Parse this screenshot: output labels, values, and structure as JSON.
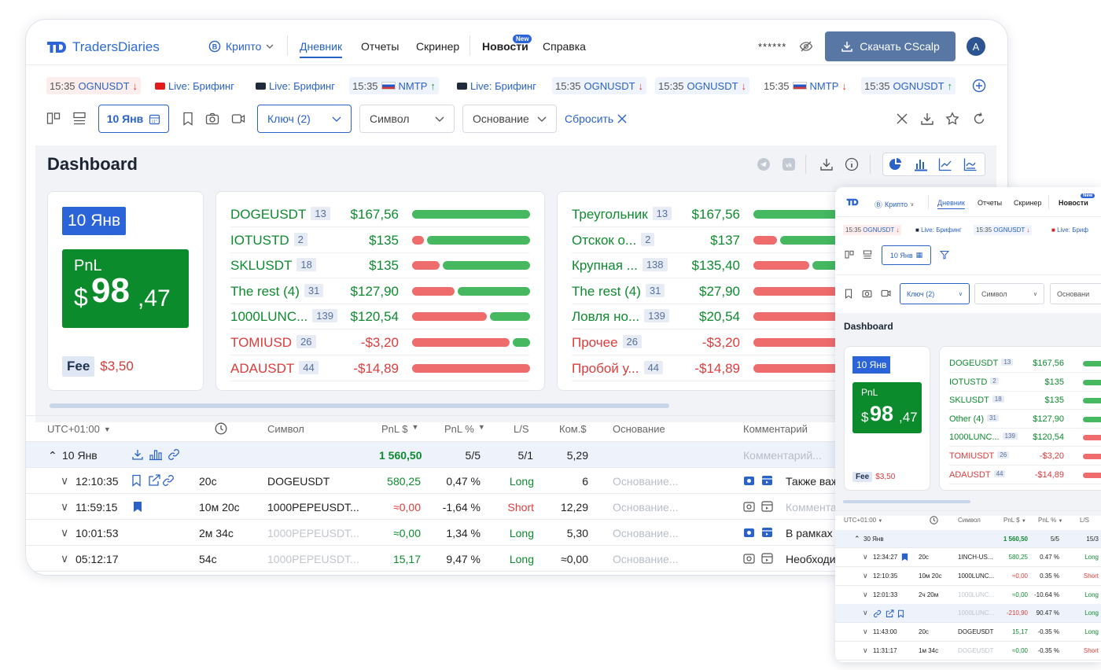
{
  "app": {
    "name": "TradersDiaries",
    "mode": "Крипто",
    "avatar": "A",
    "masked": "******",
    "download": "Скачать CScalp"
  },
  "nav": [
    {
      "label": "Дневник",
      "active": true
    },
    {
      "label": "Отчеты"
    },
    {
      "label": "Скринер"
    },
    {
      "label": "Новости",
      "badge": "New"
    },
    {
      "label": "Справка"
    }
  ],
  "tickers": [
    {
      "time": "15:35",
      "sym": "OGNUSDT",
      "dir": "down",
      "style": "red"
    },
    {
      "live": "Live: Брифинг",
      "style": "none",
      "icon": "youtube-red"
    },
    {
      "live": "Live: Брифинг",
      "style": "none",
      "icon": "youtube-dark"
    },
    {
      "time": "15:35",
      "sym": "NMTP",
      "dir": "up",
      "style": "blue",
      "flag": true
    },
    {
      "live": "Live: Брифинг",
      "style": "none",
      "icon": "youtube-dark"
    },
    {
      "time": "15:35",
      "sym": "OGNUSDT",
      "dir": "down",
      "style": "blue"
    },
    {
      "time": "15:35",
      "sym": "OGNUSDT",
      "dir": "down",
      "style": "blue"
    },
    {
      "time": "15:35",
      "sym": "NMTP",
      "dir": "down",
      "style": "none",
      "flag": true
    },
    {
      "time": "15:35",
      "sym": "OGNUSDT",
      "dir": "up",
      "style": "blue"
    }
  ],
  "filters": {
    "date": "10 Янв",
    "key": "Ключ (2)",
    "symbol": "Символ",
    "reason": "Основание",
    "reset": "Сбросить"
  },
  "dashboard": {
    "title": "Dashboard",
    "date": "10 Янв",
    "pnl_label": "PnL",
    "pnl_currency": "$",
    "pnl_int": "98",
    "pnl_dec": ",47",
    "fee_label": "Fee",
    "fee_value": "$3,50",
    "symbols": [
      {
        "name": "DOGEUSDT",
        "count": "13",
        "value": "$167,56",
        "sign": "pos",
        "red": 0.0,
        "green": 1.0
      },
      {
        "name": "IOTUSTD",
        "count": "2",
        "value": "$135",
        "sign": "pos",
        "red": 0.1,
        "green": 0.9
      },
      {
        "name": "SKLUSDT",
        "count": "18",
        "value": "$135",
        "sign": "pos",
        "red": 0.24,
        "green": 0.76
      },
      {
        "name": "The rest (4)",
        "count": "31",
        "value": "$127,90",
        "sign": "pos",
        "red": 0.37,
        "green": 0.63
      },
      {
        "name": "1000LUNC...",
        "count": "139",
        "value": "$120,54",
        "sign": "pos",
        "red": 0.65,
        "green": 0.35
      },
      {
        "name": "TOMIUSD",
        "count": "26",
        "value": "-$3,20",
        "sign": "neg",
        "red": 0.85,
        "green": 0.15
      },
      {
        "name": "ADAUSDT",
        "count": "44",
        "value": "-$14,89",
        "sign": "neg",
        "red": 1.0,
        "green": 0.0
      }
    ],
    "reasons": [
      {
        "name": "Треугольник",
        "count": "13",
        "value": "$167,56",
        "sign": "pos"
      },
      {
        "name": "Отскок о...",
        "count": "2",
        "value": "$137",
        "sign": "pos"
      },
      {
        "name": "Крупная ...",
        "count": "138",
        "value": "$135,40",
        "sign": "pos"
      },
      {
        "name": "The rest (4)",
        "count": "31",
        "value": "$27,90",
        "sign": "pos"
      },
      {
        "name": "Ловля но...",
        "count": "139",
        "value": "$20,54",
        "sign": "pos"
      },
      {
        "name": "Прочее",
        "count": "26",
        "value": "-$3,20",
        "sign": "neg"
      },
      {
        "name": "Пробой у...",
        "count": "44",
        "value": "-$14,89",
        "sign": "neg"
      }
    ]
  },
  "table": {
    "headers": {
      "tz": "UTC+01:00",
      "symbol": "Символ",
      "pnl": "PnL $",
      "pnlp": "PnL %",
      "ls": "L/S",
      "fee": "Ком.$",
      "reason": "Основание",
      "comment": "Комментарий"
    },
    "group": {
      "label": "10 Янв",
      "pnl": "1 560,50",
      "pnlp": "5/5",
      "ls": "5/1",
      "fee": "5,29",
      "comment": "Комментарий..."
    },
    "rows": [
      {
        "time": "12:10:35",
        "dur": "20с",
        "sym": "DOGEUSDT",
        "symGrey": false,
        "pnl": "580,25",
        "pnlSign": "pos",
        "pnlp": "0,47 %",
        "ls": "Long",
        "fee": "6",
        "reason": "Основание...",
        "comment": "Также важ",
        "commentPh": false,
        "icons": true,
        "bookmark": false
      },
      {
        "time": "11:59:15",
        "dur": "10м 20с",
        "sym": "1000PEPEUSDT...",
        "symGrey": false,
        "pnl": "≈0,00",
        "pnlSign": "neg",
        "pnlp": "-1,64 %",
        "ls": "Short",
        "fee": "12,29",
        "reason": "Основание...",
        "comment": "Коммента",
        "commentPh": true,
        "icons": false,
        "bookmark": true
      },
      {
        "time": "10:01:53",
        "dur": "2м 34с",
        "sym": "1000PEPEUSDT...",
        "symGrey": true,
        "pnl": "≈0,00",
        "pnlSign": "pos",
        "pnlp": "1,34 %",
        "ls": "Long",
        "fee": "5,30",
        "reason": "Основание...",
        "comment": "В рамках",
        "commentPh": false,
        "icons": false,
        "bookmark": false
      },
      {
        "time": "05:12:17",
        "dur": "54с",
        "sym": "1000PEPEUSDT...",
        "symGrey": true,
        "pnl": "15,17",
        "pnlSign": "pos",
        "pnlp": "9,47 %",
        "ls": "Long",
        "fee": "≈0,00",
        "reason": "Основание...",
        "comment": "Необходи",
        "commentPh": false,
        "icons": false,
        "bookmark": false
      }
    ]
  },
  "mobile": {
    "nav": [
      "Дневник",
      "Отчеты",
      "Скринер",
      "Новости"
    ],
    "badge": "New",
    "mode": "Крипто",
    "tickers": [
      {
        "time": "15:35",
        "sym": "OGNUSDT"
      },
      {
        "live": "Live: Брифинг"
      },
      {
        "time": "15:35",
        "sym": "OGNUSDT"
      },
      {
        "live": "Live: Бриф"
      }
    ],
    "date": "10 Янв",
    "key": "Ключ (2)",
    "symbol": "Символ",
    "reason": "Основани",
    "title": "Dashboard",
    "pnl_label": "PnL",
    "pnl_currency": "$",
    "pnl_int": "98",
    "pnl_dec": ",47",
    "fee_label": "Fee",
    "fee_value": "$3,50",
    "symbols": [
      {
        "name": "DOGEUSDT",
        "count": "13",
        "value": "$167,56",
        "sign": "pos"
      },
      {
        "name": "IOTUSTD",
        "count": "2",
        "value": "$135",
        "sign": "pos"
      },
      {
        "name": "SKLUSDT",
        "count": "18",
        "value": "$135",
        "sign": "pos"
      },
      {
        "name": "Other (4)",
        "count": "31",
        "value": "$127,90",
        "sign": "pos"
      },
      {
        "name": "1000LUNC...",
        "count": "139",
        "value": "$120,54",
        "sign": "pos"
      },
      {
        "name": "TOMIUSDT",
        "count": "26",
        "value": "-$3,20",
        "sign": "neg"
      },
      {
        "name": "ADAUSDT",
        "count": "44",
        "value": "-$14,89",
        "sign": "neg"
      }
    ],
    "headers": {
      "tz": "UTC+01:00",
      "symbol": "Символ",
      "pnl": "PnL $",
      "pnlp": "PnL %",
      "ls": "L/S"
    },
    "group": {
      "label": "30 Янв",
      "pnl": "1 560,50",
      "pnlp": "5/5",
      "ls": "15/3"
    },
    "rows": [
      {
        "time": "12:34:27",
        "dur": "20с",
        "sym": "1INCH-US...",
        "grey": false,
        "pnl": "580,25",
        "pnlSign": "pos",
        "pnlp": "0.47 %",
        "ls": "Long"
      },
      {
        "time": "12:10:35",
        "dur": "10м 20с",
        "sym": "1000LUNC...",
        "grey": false,
        "pnl": "≈0,00",
        "pnlSign": "neg",
        "pnlp": "0.35 %",
        "ls": "Short"
      },
      {
        "time": "12:01:33",
        "dur": "2ч 20м",
        "sym": "1000LUNC...",
        "grey": true,
        "pnl": "≈0,00",
        "pnlSign": "pos",
        "pnlp": "-10.64 %",
        "ls": "Long"
      },
      {
        "time": "",
        "dur": "",
        "sym": "1000LUNC...",
        "grey": true,
        "pnl": "-210,90",
        "pnlSign": "neg",
        "pnlp": "90.47 %",
        "ls": "Long",
        "icons": true
      },
      {
        "time": "11:43:00",
        "dur": "20с",
        "sym": "DOGEUSDT",
        "grey": false,
        "pnl": "15,17",
        "pnlSign": "pos",
        "pnlp": "-0.35 %",
        "ls": "Long"
      },
      {
        "time": "11:31:17",
        "dur": "1м 34с",
        "sym": "DOGEUSDT",
        "grey": true,
        "pnl": "≈0,00",
        "pnlSign": "pos",
        "pnlp": "-0.35 %",
        "ls": "Short"
      }
    ]
  },
  "colors": {
    "blue": "#2a62c8",
    "green": "#0b8b2c",
    "red": "#dd3c3c",
    "barGreen": "#45b860",
    "barRed": "#ef6c6c"
  }
}
